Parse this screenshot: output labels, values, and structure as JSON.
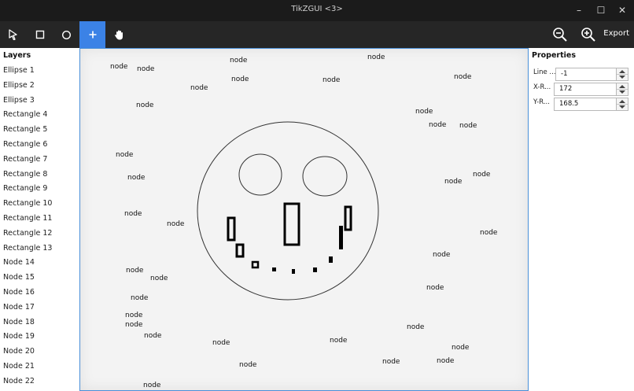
{
  "window": {
    "title": "TikZGUI <3>",
    "minimize": "–",
    "maximize": "☐",
    "close": "✕"
  },
  "toolbar": {
    "tools": [
      {
        "name": "select-tool",
        "icon": "pointer-arrow-icon"
      },
      {
        "name": "rectangle-tool",
        "icon": "square-outline-icon"
      },
      {
        "name": "ellipse-tool",
        "icon": "circle-outline-icon"
      },
      {
        "name": "add-node-tool",
        "icon": "plus-icon",
        "active": true
      },
      {
        "name": "pan-tool",
        "icon": "hand-icon"
      }
    ],
    "zoom_out_icon": "zoom-out-icon",
    "zoom_in_icon": "zoom-in-icon",
    "export_label": "Export",
    "active_color": "#3b82e6"
  },
  "layers": {
    "title": "Layers",
    "items": [
      "Ellipse 1",
      "Ellipse 2",
      "Ellipse 3",
      "Rectangle 4",
      "Rectangle 5",
      "Rectangle 6",
      "Rectangle 7",
      "Rectangle 8",
      "Rectangle 9",
      "Rectangle 10",
      "Rectangle 11",
      "Rectangle 12",
      "Rectangle 13",
      "Node 14",
      "Node 15",
      "Node 16",
      "Node 17",
      "Node 18",
      "Node 19",
      "Node 20",
      "Node 21",
      "Node 22"
    ]
  },
  "canvas": {
    "node_label": "node",
    "node_count": 45
  },
  "properties": {
    "title": "Properties",
    "fields": [
      {
        "label": "Line ...",
        "value": "-1"
      },
      {
        "label": "X-R...",
        "value": "172"
      },
      {
        "label": "Y-R...",
        "value": "168.5"
      }
    ]
  }
}
